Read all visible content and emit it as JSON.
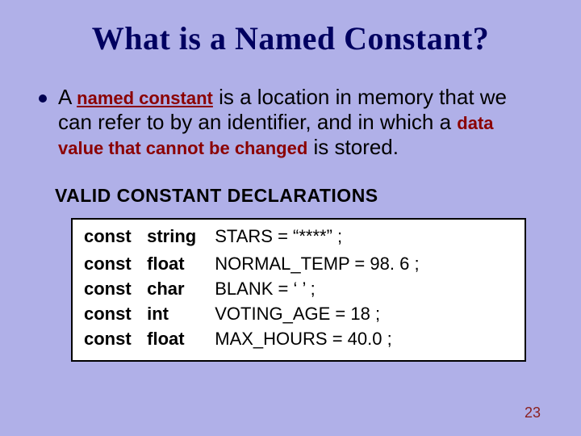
{
  "title": "What is a Named Constant?",
  "bullet": {
    "pre": "A ",
    "em1": "named constant",
    "mid": " is a location in memory that we can refer to by an identifier, and in which a ",
    "em2": "data value that cannot be changed",
    "post": " is stored."
  },
  "subhead": "VALID  CONSTANT  DECLARATIONS",
  "code": {
    "rows": [
      {
        "kw": "const",
        "ty": "string",
        "rest": "STARS  =  “****” ;"
      },
      {
        "kw": "const",
        "ty": "float",
        "rest": "NORMAL_TEMP  =  98. 6 ;"
      },
      {
        "kw": "const",
        "ty": "char",
        "rest": "BLANK =  ‘  ’ ;"
      },
      {
        "kw": "const",
        "ty": "int",
        "rest": "VOTING_AGE  =  18 ;"
      },
      {
        "kw": "const",
        "ty": "float",
        "rest": "MAX_HOURS  =  40.0 ;"
      }
    ]
  },
  "page_number": "23"
}
